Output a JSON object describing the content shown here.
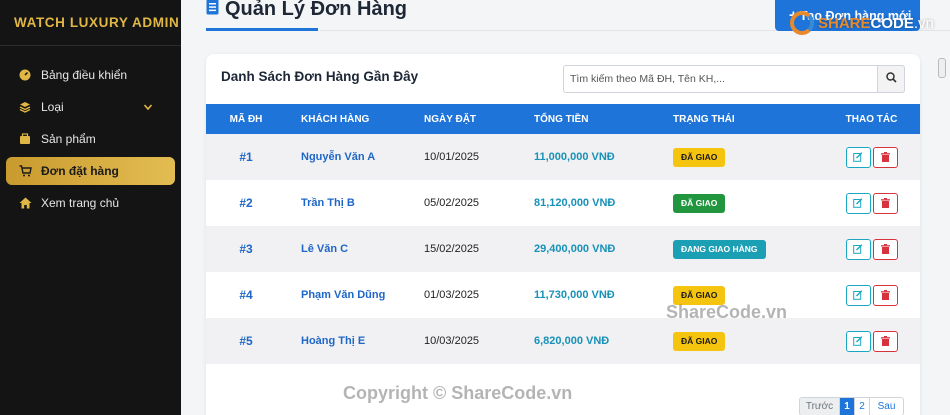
{
  "brand": "WATCH LUXURY ADMIN",
  "sidebar": {
    "items": [
      {
        "label": "Bảng điều khiển",
        "icon": "gauge-icon"
      },
      {
        "label": "Loại",
        "icon": "layers-icon"
      },
      {
        "label": "Sản phẩm",
        "icon": "box-icon"
      },
      {
        "label": "Đơn đặt hàng",
        "icon": "cart-icon"
      },
      {
        "label": "Xem trang chủ",
        "icon": "home-icon"
      }
    ]
  },
  "header": {
    "title": "Quản Lý Đơn Hàng",
    "new_button": "Tạo Đơn hàng mới"
  },
  "card": {
    "title": "Danh Sách Đơn Hàng Gần Đây",
    "search_placeholder": "Tìm kiếm theo Mã ĐH, Tên KH,..."
  },
  "table": {
    "headers": [
      "MÃ ĐH",
      "KHÁCH HÀNG",
      "NGÀY ĐẶT",
      "TỔNG TIỀN",
      "TRẠNG THÁI",
      "THAO TÁC"
    ],
    "rows": [
      {
        "id": "#1",
        "customer": "Nguyễn Văn A",
        "date": "10/01/2025",
        "total": "11,000,000 VNĐ",
        "status": "ĐÃ GIAO"
      },
      {
        "id": "#2",
        "customer": "Trần Thị B",
        "date": "05/02/2025",
        "total": "81,120,000 VNĐ",
        "status": "ĐÃ GIAO"
      },
      {
        "id": "#3",
        "customer": "Lê Văn C",
        "date": "15/02/2025",
        "total": "29,400,000 VNĐ",
        "status": "ĐANG GIAO HÀNG"
      },
      {
        "id": "#4",
        "customer": "Phạm Văn Dũng",
        "date": "01/03/2025",
        "total": "11,730,000 VNĐ",
        "status": "ĐÃ GIAO"
      },
      {
        "id": "#5",
        "customer": "Hoàng Thị E",
        "date": "10/03/2025",
        "total": "6,820,000 VNĐ",
        "status": "ĐÃ GIAO"
      }
    ]
  },
  "pagination": {
    "prev": "Trước",
    "page1": "1",
    "page2": "2",
    "next": "Sau"
  },
  "watermarks": {
    "logo_a": "SHARE",
    "logo_b": "CODE",
    "logo_c": ".vn",
    "middle": "ShareCode.vn",
    "copyright": "Copyright © ShareCode.vn"
  },
  "colors": {
    "accent": "#1e74d8",
    "gold": "#e0b644",
    "sidebar_bg": "#141414",
    "badge_yellow": "#f5c40f",
    "badge_green": "#21963f",
    "badge_teal": "#1b9fb5",
    "delete_red": "#d6333f",
    "edit_cyan": "#1aa7c4"
  }
}
